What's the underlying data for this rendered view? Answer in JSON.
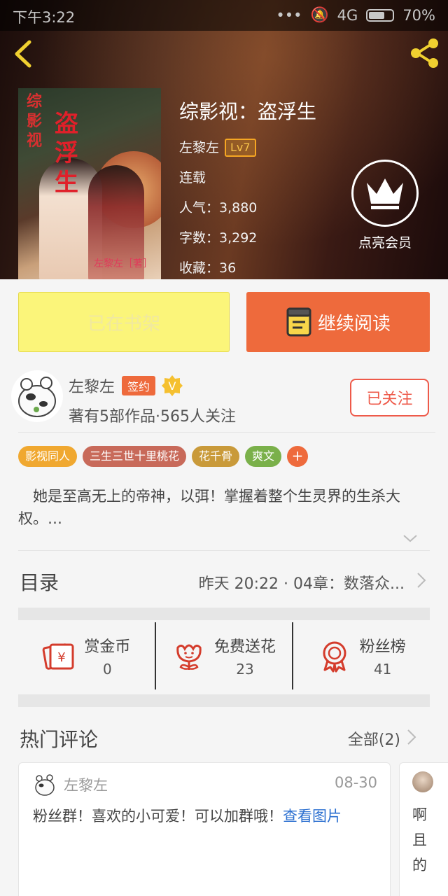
{
  "status_bar": {
    "time": "下午3:22",
    "network": "4G",
    "battery": "70%"
  },
  "book": {
    "title": "综影视：盗浮生",
    "author": "左黎左",
    "level": "Lv7",
    "status": "连载",
    "popularity": "人气：3,880",
    "word_count": "字数：3,292",
    "favorites": "收藏：36",
    "cover_title_small": "综影视",
    "cover_title_big": "盗浮生",
    "cover_author": "左黎左［著］"
  },
  "vip": {
    "label": "点亮会员"
  },
  "actions": {
    "shelf_label": "已在书架",
    "read_label": "继续阅读"
  },
  "author": {
    "name": "左黎左",
    "sign_badge": "签约",
    "v_badge": "V",
    "meta": "著有5部作品·565人关注",
    "follow_label": "已关注"
  },
  "tags": [
    {
      "label": "影视同人",
      "color": "#f0a830"
    },
    {
      "label": "三生三世十里桃花",
      "color": "#c86a5a"
    },
    {
      "label": "花千骨",
      "color": "#c99a3a"
    },
    {
      "label": "爽文",
      "color": "#7ab04a"
    }
  ],
  "tag_more": "+",
  "description": "她是至高无上的帝神，以弭！掌握着整个生灵界的生杀大权。…",
  "toc": {
    "label": "目录",
    "latest": "昨天 20:22 · 04章：数落众..."
  },
  "stats": [
    {
      "label": "赏金币",
      "value": "0",
      "icon": "reward-envelope-icon"
    },
    {
      "label": "免费送花",
      "value": "23",
      "icon": "flower-icon"
    },
    {
      "label": "粉丝榜",
      "value": "41",
      "icon": "fan-rank-medal-icon"
    }
  ],
  "comments": {
    "title": "热门评论",
    "all_label": "全部(2)",
    "items": [
      {
        "author": "左黎左",
        "date": "08-30",
        "text": "粉丝群！喜欢的小可爱！可以加群哦！",
        "link": "查看图片"
      },
      {
        "text": "啊且的"
      }
    ]
  },
  "colors": {
    "accent": "#ee6a3c",
    "shelf_yellow": "#fbf57a",
    "link": "#2b6fd0",
    "follow": "#ee5a4a"
  }
}
